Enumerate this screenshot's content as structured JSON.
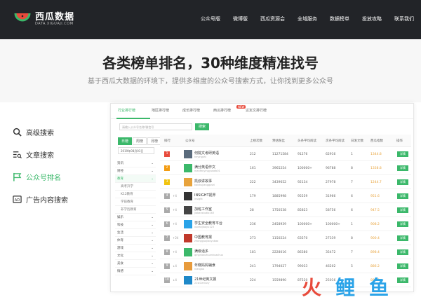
{
  "brand": {
    "name_cn": "西瓜数据",
    "name_en": "DATA.XIGUAJI.COM"
  },
  "topnav": [
    "公众号版",
    "微博版",
    "西瓜资源会",
    "全域服务",
    "数据榜单",
    "投放攻略",
    "联系我们"
  ],
  "hero": {
    "title": "各类榜单排名，30种维度精准找号",
    "subtitle": "基于西瓜大数据的环境下，提供多维度的公众号搜索方式，让你找到更多公众号"
  },
  "leftnav": [
    {
      "label": "高级搜索",
      "icon": "search-icon"
    },
    {
      "label": "文章搜索",
      "icon": "article-search-icon"
    },
    {
      "label": "公众号排名",
      "icon": "flag-icon"
    },
    {
      "label": "广告内容搜索",
      "icon": "ad-icon"
    }
  ],
  "tabs": [
    "行业排行榜",
    "地区排行榜",
    "成长排行榜",
    "西瓜排行榜",
    "达定文排行榜"
  ],
  "new_badge": "NEW",
  "search": {
    "placeholder": "请输入公众号名称/微信号",
    "button": "搜索"
  },
  "periods": [
    "日榜",
    "周榜",
    "月榜"
  ],
  "date": "2019年08月03日",
  "categories": [
    {
      "label": "资讯",
      "type": "main"
    },
    {
      "label": "财经",
      "type": "main"
    },
    {
      "label": "教育",
      "type": "main",
      "active": true
    },
    {
      "label": "高考升学",
      "type": "sub"
    },
    {
      "label": "K12教育",
      "type": "sub"
    },
    {
      "label": "学前教育",
      "type": "sub"
    },
    {
      "label": "非学历教育",
      "type": "sub"
    },
    {
      "label": "娱乐",
      "type": "main"
    },
    {
      "label": "科技",
      "type": "main"
    },
    {
      "label": "生活",
      "type": "main"
    },
    {
      "label": "体育",
      "type": "main"
    },
    {
      "label": "游戏",
      "type": "main"
    },
    {
      "label": "文化",
      "type": "main"
    },
    {
      "label": "美食",
      "type": "main"
    },
    {
      "label": "情感",
      "type": "main"
    }
  ],
  "table": {
    "headers": [
      "排行",
      "公众号",
      "上榜次数",
      "预估粉丝",
      "头条平均阅读",
      "次条平均阅读",
      "日发文数",
      "西瓜指数",
      "操作"
    ],
    "detail_label": "详情",
    "rows": [
      {
        "rank": "1",
        "trend": "",
        "name": "何院文考研英语",
        "id": "heyingshi",
        "c1": "212",
        "c2": "11271584",
        "c3": "91276",
        "c4": "62916",
        "c5": "1",
        "score": "1344.8"
      },
      {
        "rank": "2",
        "trend": "",
        "name": "满分英语作文",
        "id": "manfenyingyuweb01",
        "c1": "161",
        "c2": "3965254",
        "c3": "100000+",
        "c4": "96788",
        "c5": "8",
        "score": "1338.8"
      },
      {
        "rank": "3",
        "trend": "",
        "name": "凯叔讲故事",
        "id": "kaishujianggushi",
        "c1": "222",
        "c2": "3439652",
        "c3": "92134",
        "c4": "27978",
        "c5": "7",
        "score": "1244.7"
      },
      {
        "rank": "4",
        "trend": "↑4",
        "name": "INSIGHT视界",
        "id": "insight",
        "c1": "179",
        "c2": "1885998",
        "c3": "95559",
        "c4": "31966",
        "c5": "6",
        "score": "951.6"
      },
      {
        "rank": "5",
        "trend": "↑4",
        "name": "加班工作室",
        "id": "jiabanstudio163",
        "c1": "28",
        "c2": "1750538",
        "c3": "85823",
        "c4": "58756",
        "c5": "6",
        "score": "947.5"
      },
      {
        "rank": "6",
        "trend": "↑4",
        "name": "学生安全教育平台",
        "id": "xueanjiaoyu123",
        "c1": "236",
        "c2": "2458939",
        "c3": "100000+",
        "c4": "100000+",
        "c5": "1",
        "score": "908.2"
      },
      {
        "rank": "7",
        "trend": "↑24",
        "name": "中国教育报",
        "id": "zhongguojiaoyubao",
        "c1": "273",
        "c2": "1150224",
        "c3": "63570",
        "c4": "27339",
        "c5": "8",
        "score": "900.4"
      },
      {
        "rank": "8",
        "trend": "↑4",
        "name": "满级话多",
        "id": "qingnianzhuanhuashuo",
        "c1": "181",
        "c2": "2228016",
        "c3": "86380",
        "c4": "35472",
        "c5": "7",
        "score": "898.4"
      },
      {
        "rank": "9",
        "trend": "↓4",
        "name": "年糕妈妈辅食",
        "id": "niangao",
        "c1": "241",
        "c2": "1794027",
        "c3": "99033",
        "c4": "46202",
        "c5": "5",
        "score": "886.2"
      },
      {
        "rank": "10",
        "trend": "↓4",
        "name": "21世纪英文报",
        "id": "21stCentury",
        "c1": "224",
        "c2": "1559890",
        "c3": "87520",
        "c4": "25016",
        "c5": "6",
        "score": "880.2"
      }
    ]
  },
  "watermark": "火鲤鱼",
  "colors": {
    "accent": "#3bb86a",
    "topbar": "#222428",
    "rank1": "#e84b3c",
    "rank2": "#f39c12",
    "rank3": "#f1c40f",
    "rankN": "#aaaaaa",
    "watermark_red": "#e84b3c",
    "watermark_blue": "#2aa3e8"
  }
}
